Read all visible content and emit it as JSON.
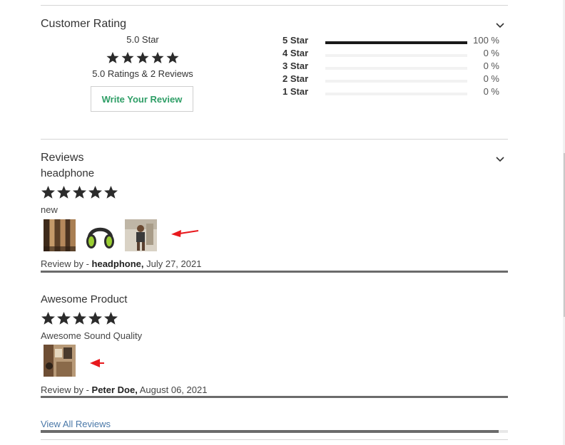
{
  "rating_section": {
    "title": "Customer Rating",
    "avg_label": "5.0 Star",
    "stars": 5,
    "count_text": "5.0 Ratings & 2 Reviews",
    "write_review_label": "Write Your Review",
    "distribution": [
      {
        "label": "5 Star",
        "percent_text": "100 %",
        "fraction": 1.0
      },
      {
        "label": "4 Star",
        "percent_text": "0 %",
        "fraction": 0.0
      },
      {
        "label": "3 Star",
        "percent_text": "0 %",
        "fraction": 0.0
      },
      {
        "label": "2 Star",
        "percent_text": "0 %",
        "fraction": 0.0
      },
      {
        "label": "1 Star",
        "percent_text": "0 %",
        "fraction": 0.0
      }
    ]
  },
  "reviews_section": {
    "title": "Reviews",
    "reviews": [
      {
        "title": "headphone",
        "stars": 5,
        "text": "new",
        "images": [
          "curtain-photo",
          "headphone-photo",
          "person-photo"
        ],
        "by_prefix": "Review by - ",
        "author": "headphone,",
        "date": "July 27, 2021"
      },
      {
        "title": "Awesome Product",
        "stars": 5,
        "text": "Awesome Sound Quality",
        "images": [
          "room-photo"
        ],
        "by_prefix": "Review by - ",
        "author": "Peter Doe,",
        "date": "August 06, 2021"
      }
    ],
    "view_all_label": "View All Reviews"
  },
  "colors": {
    "accent_green": "#2e9e66",
    "link_blue": "#4a78a8",
    "annotation_red": "#e8191d",
    "star": "#2b2b2b"
  },
  "icons": [
    "chevron-down-icon",
    "star-icon",
    "red-arrow-annotation"
  ]
}
